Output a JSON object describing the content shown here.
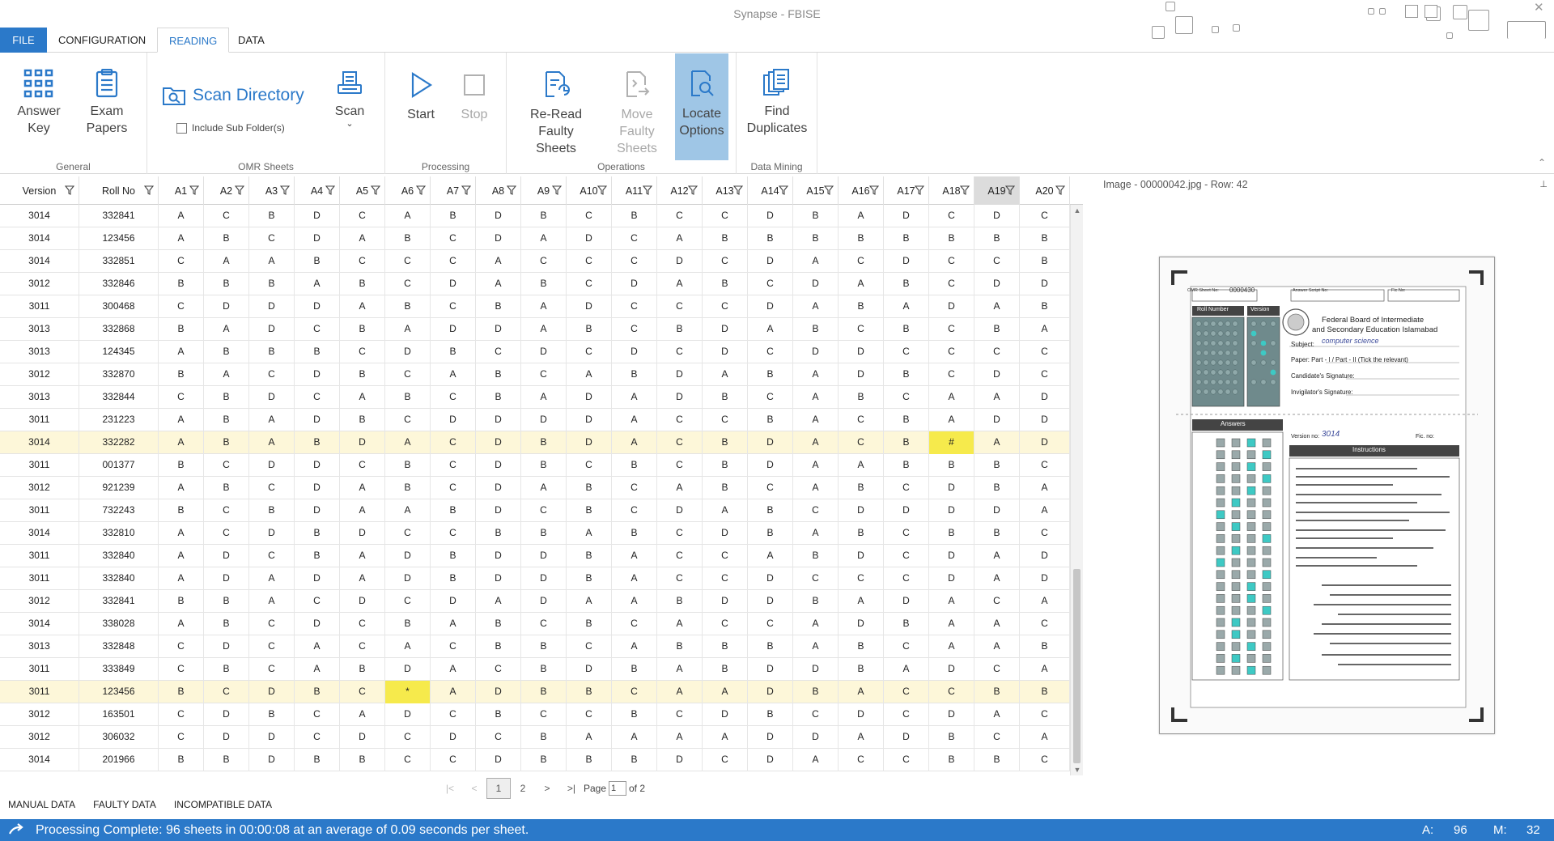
{
  "window": {
    "title": "Synapse - FBISE"
  },
  "menu": {
    "tabs": [
      "FILE",
      "CONFIGURATION",
      "READING",
      "DATA"
    ],
    "active": "READING"
  },
  "ribbon": {
    "general": {
      "label": "General",
      "answer_key_1": "Answer",
      "answer_key_2": "Key",
      "exam_papers_1": "Exam",
      "exam_papers_2": "Papers"
    },
    "omr": {
      "label": "OMR Sheets",
      "scan_directory": "Scan Directory",
      "include_sub": "Include Sub Folder(s)",
      "scan": "Scan",
      "scan_arrow": "⌄"
    },
    "processing": {
      "label": "Processing",
      "start": "Start",
      "stop": "Stop"
    },
    "operations": {
      "label": "Operations",
      "reread_1": "Re-Read",
      "reread_2": "Faulty Sheets",
      "move_1": "Move",
      "move_2": "Faulty Sheets",
      "locate_1": "Locate",
      "locate_2": "Options"
    },
    "datamining": {
      "label": "Data Mining",
      "find_1": "Find",
      "find_2": "Duplicates"
    },
    "collapse": "⌃"
  },
  "grid": {
    "columns": [
      "Version",
      "Roll No",
      "A1",
      "A2",
      "A3",
      "A4",
      "A5",
      "A6",
      "A7",
      "A8",
      "A9",
      "A10",
      "A11",
      "A12",
      "A13",
      "A14",
      "A15",
      "A16",
      "A17",
      "A18",
      "A19",
      "A20"
    ],
    "selected_column": "A19",
    "rows": [
      [
        "3014",
        "332841",
        "A",
        "C",
        "B",
        "D",
        "C",
        "A",
        "B",
        "D",
        "B",
        "C",
        "B",
        "C",
        "C",
        "D",
        "B",
        "A",
        "D",
        "C",
        "D",
        "C"
      ],
      [
        "3014",
        "123456",
        "A",
        "B",
        "C",
        "D",
        "A",
        "B",
        "C",
        "D",
        "A",
        "D",
        "C",
        "A",
        "B",
        "B",
        "B",
        "B",
        "B",
        "B",
        "B",
        "B"
      ],
      [
        "3014",
        "332851",
        "C",
        "A",
        "A",
        "B",
        "C",
        "C",
        "C",
        "A",
        "C",
        "C",
        "C",
        "D",
        "C",
        "D",
        "A",
        "C",
        "D",
        "C",
        "C",
        "B"
      ],
      [
        "3012",
        "332846",
        "B",
        "B",
        "B",
        "A",
        "B",
        "C",
        "D",
        "A",
        "B",
        "C",
        "D",
        "A",
        "B",
        "C",
        "D",
        "A",
        "B",
        "C",
        "D",
        "D"
      ],
      [
        "3011",
        "300468",
        "C",
        "D",
        "D",
        "D",
        "A",
        "B",
        "C",
        "B",
        "A",
        "D",
        "C",
        "C",
        "C",
        "D",
        "A",
        "B",
        "A",
        "D",
        "A",
        "B"
      ],
      [
        "3013",
        "332868",
        "B",
        "A",
        "D",
        "C",
        "B",
        "A",
        "D",
        "D",
        "A",
        "B",
        "C",
        "B",
        "D",
        "A",
        "B",
        "C",
        "B",
        "C",
        "B",
        "A"
      ],
      [
        "3013",
        "124345",
        "A",
        "B",
        "B",
        "B",
        "C",
        "D",
        "B",
        "C",
        "D",
        "C",
        "D",
        "C",
        "D",
        "C",
        "D",
        "D",
        "C",
        "C",
        "C",
        "C"
      ],
      [
        "3012",
        "332870",
        "B",
        "A",
        "C",
        "D",
        "B",
        "C",
        "A",
        "B",
        "C",
        "A",
        "B",
        "D",
        "A",
        "B",
        "A",
        "D",
        "B",
        "C",
        "D",
        "C"
      ],
      [
        "3013",
        "332844",
        "C",
        "B",
        "D",
        "C",
        "A",
        "B",
        "C",
        "B",
        "A",
        "D",
        "A",
        "D",
        "B",
        "C",
        "A",
        "B",
        "C",
        "A",
        "A",
        "D"
      ],
      [
        "3011",
        "231223",
        "A",
        "B",
        "A",
        "D",
        "B",
        "C",
        "D",
        "D",
        "D",
        "D",
        "A",
        "C",
        "C",
        "B",
        "A",
        "C",
        "B",
        "A",
        "D",
        "D"
      ],
      [
        "3014",
        "332282",
        "A",
        "B",
        "A",
        "B",
        "D",
        "A",
        "C",
        "D",
        "B",
        "D",
        "A",
        "C",
        "B",
        "D",
        "A",
        "C",
        "B",
        "#",
        "A",
        "D"
      ],
      [
        "3011",
        "001377",
        "B",
        "C",
        "D",
        "D",
        "C",
        "B",
        "C",
        "D",
        "B",
        "C",
        "B",
        "C",
        "B",
        "D",
        "A",
        "A",
        "B",
        "B",
        "B",
        "C"
      ],
      [
        "3012",
        "921239",
        "A",
        "B",
        "C",
        "D",
        "A",
        "B",
        "C",
        "D",
        "A",
        "B",
        "C",
        "A",
        "B",
        "C",
        "A",
        "B",
        "C",
        "D",
        "B",
        "A"
      ],
      [
        "3011",
        "732243",
        "B",
        "C",
        "B",
        "D",
        "A",
        "A",
        "B",
        "D",
        "C",
        "B",
        "C",
        "D",
        "A",
        "B",
        "C",
        "D",
        "D",
        "D",
        "D",
        "A"
      ],
      [
        "3014",
        "332810",
        "A",
        "C",
        "D",
        "B",
        "D",
        "C",
        "C",
        "B",
        "B",
        "A",
        "B",
        "C",
        "D",
        "B",
        "A",
        "B",
        "C",
        "B",
        "B",
        "C"
      ],
      [
        "3011",
        "332840",
        "A",
        "D",
        "C",
        "B",
        "A",
        "D",
        "B",
        "D",
        "D",
        "B",
        "A",
        "C",
        "C",
        "A",
        "B",
        "D",
        "C",
        "D",
        "A",
        "D"
      ],
      [
        "3011",
        "332840",
        "A",
        "D",
        "A",
        "D",
        "A",
        "D",
        "B",
        "D",
        "D",
        "B",
        "A",
        "C",
        "C",
        "D",
        "C",
        "C",
        "C",
        "D",
        "A",
        "D"
      ],
      [
        "3012",
        "332841",
        "B",
        "B",
        "A",
        "C",
        "D",
        "C",
        "D",
        "A",
        "D",
        "A",
        "A",
        "B",
        "D",
        "D",
        "B",
        "A",
        "D",
        "A",
        "C",
        "A"
      ],
      [
        "3014",
        "338028",
        "A",
        "B",
        "C",
        "D",
        "C",
        "B",
        "A",
        "B",
        "C",
        "B",
        "C",
        "A",
        "C",
        "C",
        "A",
        "D",
        "B",
        "A",
        "A",
        "C"
      ],
      [
        "3013",
        "332848",
        "C",
        "D",
        "C",
        "A",
        "C",
        "A",
        "C",
        "B",
        "B",
        "C",
        "A",
        "B",
        "B",
        "B",
        "A",
        "B",
        "C",
        "A",
        "A",
        "B"
      ],
      [
        "3011",
        "333849",
        "C",
        "B",
        "C",
        "A",
        "B",
        "D",
        "A",
        "C",
        "B",
        "D",
        "B",
        "A",
        "B",
        "D",
        "D",
        "B",
        "A",
        "D",
        "C",
        "A"
      ],
      [
        "3011",
        "123456",
        "B",
        "C",
        "D",
        "B",
        "C",
        "*",
        "A",
        "D",
        "B",
        "B",
        "C",
        "A",
        "A",
        "D",
        "B",
        "A",
        "C",
        "C",
        "B",
        "B"
      ],
      [
        "3012",
        "163501",
        "C",
        "D",
        "B",
        "C",
        "A",
        "D",
        "C",
        "B",
        "C",
        "C",
        "B",
        "C",
        "D",
        "B",
        "C",
        "D",
        "C",
        "D",
        "A",
        "C"
      ],
      [
        "3012",
        "306032",
        "C",
        "D",
        "D",
        "C",
        "D",
        "C",
        "D",
        "C",
        "B",
        "A",
        "A",
        "A",
        "A",
        "D",
        "D",
        "A",
        "D",
        "B",
        "C",
        "A"
      ],
      [
        "3014",
        "201966",
        "B",
        "B",
        "D",
        "B",
        "B",
        "C",
        "C",
        "D",
        "B",
        "B",
        "B",
        "D",
        "C",
        "D",
        "A",
        "C",
        "C",
        "B",
        "B",
        "C"
      ]
    ],
    "highlight_rows": [
      10,
      21
    ],
    "error_cells": [
      [
        10,
        "A18"
      ],
      [
        21,
        "A6"
      ]
    ]
  },
  "pager": {
    "first": "|<",
    "prev": "<",
    "next": ">",
    "last": ">|",
    "pages": [
      "1",
      "2"
    ],
    "current_page": "1",
    "page_label": "Page",
    "of_label": "of 2"
  },
  "bottom_tabs": [
    "MANUAL DATA",
    "FAULTY DATA",
    "INCOMPATIBLE DATA"
  ],
  "image_panel": {
    "title": "Image - 00000042.jpg - Row: 42",
    "pin": "⊥",
    "sheet": {
      "omr_label": "OMR Sheet No:",
      "omr_no": "0000430",
      "answer_script": "Answer Script No:",
      "fic_no": "Fic No:",
      "roll_header": "Roll Number",
      "version_header": "Version",
      "board_1": "Federal Board of Intermediate",
      "board_2": "and Secondary Education Islamabad",
      "subject_label": "Subject:",
      "subject_value": "computer science",
      "paper_label": "Paper: Part - I / Part - II (Tick the relevant)",
      "candidate_sig": "Candidate's Signature:",
      "invigilator_sig": "Invigilator's Signature:",
      "answers_header": "Answers",
      "version_no_label": "Version no:",
      "version_no_value": "3014",
      "fic_label": "Fic. no:",
      "instructions_header": "Instructions"
    }
  },
  "status": {
    "message": "Processing Complete: 96 sheets in 00:00:08 at an average of 0.09 seconds per sheet.",
    "a_label": "A:",
    "a_value": "96",
    "m_label": "M:",
    "m_value": "32"
  }
}
